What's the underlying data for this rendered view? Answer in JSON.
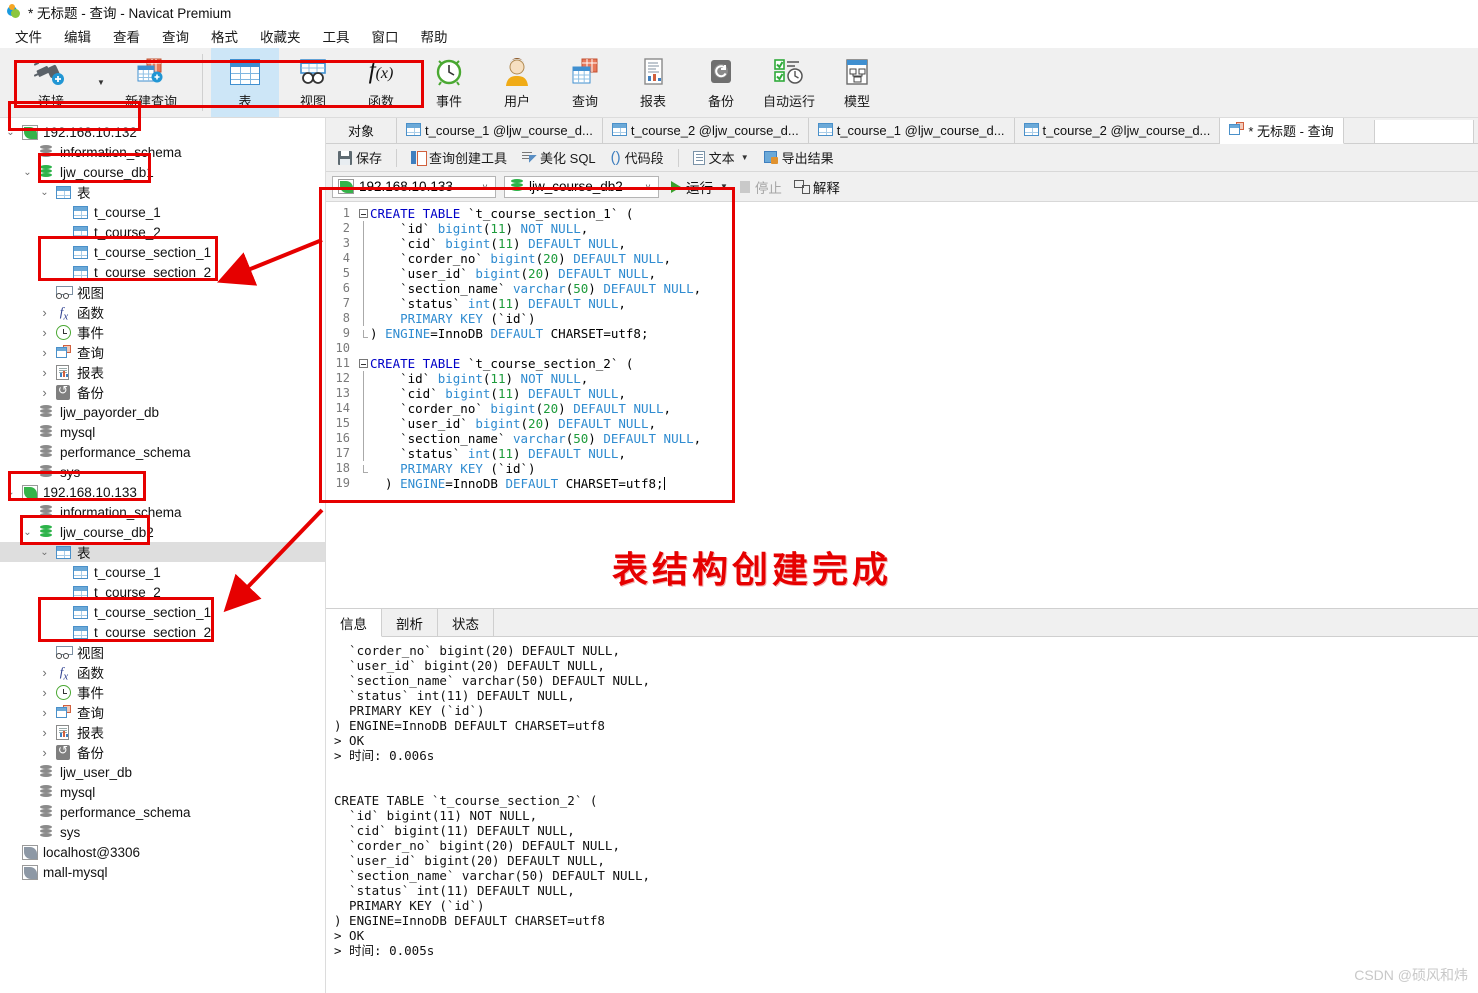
{
  "window": {
    "title": "* 无标题 - 查询 - Navicat Premium",
    "logo_icon": "navicat-logo-icon"
  },
  "menubar": {
    "items": [
      "文件",
      "编辑",
      "查看",
      "查询",
      "格式",
      "收藏夹",
      "工具",
      "窗口",
      "帮助"
    ]
  },
  "toolbar": {
    "left": [
      {
        "label": "连接",
        "icon": "connection-plug-icon",
        "has_caret": true
      },
      {
        "label": "新建查询",
        "icon": "new-query-icon",
        "has_caret": false
      }
    ],
    "items": [
      {
        "label": "表",
        "icon": "table-grid-icon",
        "active": true
      },
      {
        "label": "视图",
        "icon": "view-icon",
        "active": false
      },
      {
        "label": "函数",
        "icon": "function-fx-icon",
        "active": false
      },
      {
        "label": "事件",
        "icon": "event-clock-icon",
        "active": false
      },
      {
        "label": "用户",
        "icon": "user-icon",
        "active": false
      },
      {
        "label": "查询",
        "icon": "query-icon",
        "active": false
      },
      {
        "label": "报表",
        "icon": "report-icon",
        "active": false
      },
      {
        "label": "备份",
        "icon": "backup-icon",
        "active": false
      },
      {
        "label": "自动运行",
        "icon": "automation-icon",
        "active": false
      },
      {
        "label": "模型",
        "icon": "model-icon",
        "active": false
      }
    ]
  },
  "object_tabs": {
    "first_label": "对象",
    "tabs": [
      {
        "label": "t_course_1 @ljw_course_d...",
        "icon": "table-tab-icon",
        "active": false
      },
      {
        "label": "t_course_2 @ljw_course_d...",
        "icon": "table-tab-icon",
        "active": false
      },
      {
        "label": "t_course_1 @ljw_course_d...",
        "icon": "table-tab-icon",
        "active": false
      },
      {
        "label": "t_course_2 @ljw_course_d...",
        "icon": "table-tab-icon",
        "active": false
      },
      {
        "label": "* 无标题 - 查询",
        "icon": "query-tab-icon",
        "active": true
      }
    ]
  },
  "editor_toolbar": {
    "save": "保存",
    "query_builder": "查询创建工具",
    "beautify": "美化 SQL",
    "snippet": "代码段",
    "text": "文本",
    "export": "导出结果"
  },
  "selector": {
    "connection": "192.168.10.133",
    "database": "ljw_course_db2",
    "run": "运行",
    "stop": "停止",
    "explain": "解释"
  },
  "sql_editor": {
    "lines": [
      {
        "n": 1,
        "fold": "start",
        "tokens": [
          [
            "kw",
            "CREATE TABLE "
          ],
          [
            "id",
            "`t_course_section_1` ("
          ]
        ]
      },
      {
        "n": 2,
        "fold": "bar",
        "tokens": [
          [
            "txt",
            "    `id` "
          ],
          [
            "type",
            "bigint"
          ],
          [
            "id",
            "("
          ],
          [
            "num",
            "11"
          ],
          [
            "id",
            ") "
          ],
          [
            "type",
            "NOT NULL"
          ],
          [
            "id",
            ","
          ]
        ]
      },
      {
        "n": 3,
        "fold": "bar",
        "tokens": [
          [
            "txt",
            "    `cid` "
          ],
          [
            "type",
            "bigint"
          ],
          [
            "id",
            "("
          ],
          [
            "num",
            "11"
          ],
          [
            "id",
            ") "
          ],
          [
            "type",
            "DEFAULT NULL"
          ],
          [
            "id",
            ","
          ]
        ]
      },
      {
        "n": 4,
        "fold": "bar",
        "tokens": [
          [
            "txt",
            "    `corder_no` "
          ],
          [
            "type",
            "bigint"
          ],
          [
            "id",
            "("
          ],
          [
            "num",
            "20"
          ],
          [
            "id",
            ") "
          ],
          [
            "type",
            "DEFAULT NULL"
          ],
          [
            "id",
            ","
          ]
        ]
      },
      {
        "n": 5,
        "fold": "bar",
        "tokens": [
          [
            "txt",
            "    `user_id` "
          ],
          [
            "type",
            "bigint"
          ],
          [
            "id",
            "("
          ],
          [
            "num",
            "20"
          ],
          [
            "id",
            ") "
          ],
          [
            "type",
            "DEFAULT NULL"
          ],
          [
            "id",
            ","
          ]
        ]
      },
      {
        "n": 6,
        "fold": "bar",
        "tokens": [
          [
            "txt",
            "    `section_name` "
          ],
          [
            "type",
            "varchar"
          ],
          [
            "id",
            "("
          ],
          [
            "num",
            "50"
          ],
          [
            "id",
            ") "
          ],
          [
            "type",
            "DEFAULT NULL"
          ],
          [
            "id",
            ","
          ]
        ]
      },
      {
        "n": 7,
        "fold": "bar",
        "tokens": [
          [
            "txt",
            "    `status` "
          ],
          [
            "type",
            "int"
          ],
          [
            "id",
            "("
          ],
          [
            "num",
            "11"
          ],
          [
            "id",
            ") "
          ],
          [
            "type",
            "DEFAULT NULL"
          ],
          [
            "id",
            ","
          ]
        ]
      },
      {
        "n": 8,
        "fold": "bar",
        "tokens": [
          [
            "type",
            "    PRIMARY KEY "
          ],
          [
            "id",
            "(`id`)"
          ]
        ]
      },
      {
        "n": 9,
        "fold": "end",
        "tokens": [
          [
            "id",
            ") "
          ],
          [
            "type",
            "ENGINE"
          ],
          [
            "id",
            "=InnoDB "
          ],
          [
            "type",
            "DEFAULT"
          ],
          [
            "id",
            " CHARSET=utf8;"
          ]
        ]
      },
      {
        "n": 10,
        "fold": "none",
        "tokens": [
          [
            "txt",
            ""
          ]
        ]
      },
      {
        "n": 11,
        "fold": "start",
        "tokens": [
          [
            "kw",
            "CREATE TABLE "
          ],
          [
            "id",
            "`t_course_section_2` ("
          ]
        ]
      },
      {
        "n": 12,
        "fold": "bar",
        "tokens": [
          [
            "txt",
            "    `id` "
          ],
          [
            "type",
            "bigint"
          ],
          [
            "id",
            "("
          ],
          [
            "num",
            "11"
          ],
          [
            "id",
            ") "
          ],
          [
            "type",
            "NOT NULL"
          ],
          [
            "id",
            ","
          ]
        ]
      },
      {
        "n": 13,
        "fold": "bar",
        "tokens": [
          [
            "txt",
            "    `cid` "
          ],
          [
            "type",
            "bigint"
          ],
          [
            "id",
            "("
          ],
          [
            "num",
            "11"
          ],
          [
            "id",
            ") "
          ],
          [
            "type",
            "DEFAULT NULL"
          ],
          [
            "id",
            ","
          ]
        ]
      },
      {
        "n": 14,
        "fold": "bar",
        "tokens": [
          [
            "txt",
            "    `corder_no` "
          ],
          [
            "type",
            "bigint"
          ],
          [
            "id",
            "("
          ],
          [
            "num",
            "20"
          ],
          [
            "id",
            ") "
          ],
          [
            "type",
            "DEFAULT NULL"
          ],
          [
            "id",
            ","
          ]
        ]
      },
      {
        "n": 15,
        "fold": "bar",
        "tokens": [
          [
            "txt",
            "    `user_id` "
          ],
          [
            "type",
            "bigint"
          ],
          [
            "id",
            "("
          ],
          [
            "num",
            "20"
          ],
          [
            "id",
            ") "
          ],
          [
            "type",
            "DEFAULT NULL"
          ],
          [
            "id",
            ","
          ]
        ]
      },
      {
        "n": 16,
        "fold": "bar",
        "tokens": [
          [
            "txt",
            "    `section_name` "
          ],
          [
            "type",
            "varchar"
          ],
          [
            "id",
            "("
          ],
          [
            "num",
            "50"
          ],
          [
            "id",
            ") "
          ],
          [
            "type",
            "DEFAULT NULL"
          ],
          [
            "id",
            ","
          ]
        ]
      },
      {
        "n": 17,
        "fold": "bar",
        "tokens": [
          [
            "txt",
            "    `status` "
          ],
          [
            "type",
            "int"
          ],
          [
            "id",
            "("
          ],
          [
            "num",
            "11"
          ],
          [
            "id",
            ") "
          ],
          [
            "type",
            "DEFAULT NULL"
          ],
          [
            "id",
            ","
          ]
        ]
      },
      {
        "n": 18,
        "fold": "end",
        "tokens": [
          [
            "type",
            "    PRIMARY KEY "
          ],
          [
            "id",
            "(`id`)"
          ]
        ]
      },
      {
        "n": 19,
        "fold": "none",
        "tokens": [
          [
            "id",
            "  ) "
          ],
          [
            "type",
            "ENGINE"
          ],
          [
            "id",
            "=InnoDB "
          ],
          [
            "type",
            "DEFAULT"
          ],
          [
            "id",
            " CHARSET=utf8;"
          ]
        ],
        "caret": true
      }
    ]
  },
  "results": {
    "tabs": [
      {
        "label": "信息",
        "active": true
      },
      {
        "label": "剖析",
        "active": false
      },
      {
        "label": "状态",
        "active": false
      }
    ],
    "lines": [
      "  `corder_no` bigint(20) DEFAULT NULL,",
      "  `user_id` bigint(20) DEFAULT NULL,",
      "  `section_name` varchar(50) DEFAULT NULL,",
      "  `status` int(11) DEFAULT NULL,",
      "  PRIMARY KEY (`id`)",
      ") ENGINE=InnoDB DEFAULT CHARSET=utf8",
      "> OK",
      "> 时间: 0.006s",
      "",
      "",
      "CREATE TABLE `t_course_section_2` (",
      "  `id` bigint(11) NOT NULL,",
      "  `cid` bigint(11) DEFAULT NULL,",
      "  `corder_no` bigint(20) DEFAULT NULL,",
      "  `user_id` bigint(20) DEFAULT NULL,",
      "  `section_name` varchar(50) DEFAULT NULL,",
      "  `status` int(11) DEFAULT NULL,",
      "  PRIMARY KEY (`id`)",
      ") ENGINE=InnoDB DEFAULT CHARSET=utf8",
      "> OK",
      "> 时间: 0.005s"
    ]
  },
  "tree": {
    "nodes": [
      {
        "label": "192.168.10.132",
        "icon": "connection-green-icon",
        "indent": 0,
        "twisty": "down",
        "selected": false
      },
      {
        "label": "information_schema",
        "icon": "database-gray-icon",
        "indent": 1,
        "twisty": "",
        "selected": false
      },
      {
        "label": "ljw_course_db1",
        "icon": "database-green-icon",
        "indent": 1,
        "twisty": "down",
        "selected": false
      },
      {
        "label": "表",
        "icon": "table-folder-icon",
        "indent": 2,
        "twisty": "down",
        "selected": false
      },
      {
        "label": "t_course_1",
        "icon": "table-icon",
        "indent": 3,
        "twisty": "",
        "selected": false
      },
      {
        "label": "t_course_2",
        "icon": "table-icon",
        "indent": 3,
        "twisty": "",
        "selected": false
      },
      {
        "label": "t_course_section_1",
        "icon": "table-icon",
        "indent": 3,
        "twisty": "",
        "selected": false
      },
      {
        "label": "t_course_section_2",
        "icon": "table-icon",
        "indent": 3,
        "twisty": "",
        "selected": false
      },
      {
        "label": "视图",
        "icon": "view-icon",
        "indent": 2,
        "twisty": "",
        "selected": false
      },
      {
        "label": "函数",
        "icon": "function-fx-icon",
        "indent": 2,
        "twisty": "right",
        "selected": false
      },
      {
        "label": "事件",
        "icon": "event-clock-icon",
        "indent": 2,
        "twisty": "right",
        "selected": false
      },
      {
        "label": "查询",
        "icon": "query-icon",
        "indent": 2,
        "twisty": "right",
        "selected": false
      },
      {
        "label": "报表",
        "icon": "report-icon",
        "indent": 2,
        "twisty": "right",
        "selected": false
      },
      {
        "label": "备份",
        "icon": "backup-icon",
        "indent": 2,
        "twisty": "right",
        "selected": false
      },
      {
        "label": "ljw_payorder_db",
        "icon": "database-gray-icon",
        "indent": 1,
        "twisty": "",
        "selected": false
      },
      {
        "label": "mysql",
        "icon": "database-gray-icon",
        "indent": 1,
        "twisty": "",
        "selected": false
      },
      {
        "label": "performance_schema",
        "icon": "database-gray-icon",
        "indent": 1,
        "twisty": "",
        "selected": false
      },
      {
        "label": "sys",
        "icon": "database-gray-icon",
        "indent": 1,
        "twisty": "",
        "selected": false
      },
      {
        "label": "192.168.10.133",
        "icon": "connection-green-icon",
        "indent": 0,
        "twisty": "down",
        "selected": false
      },
      {
        "label": "information_schema",
        "icon": "database-gray-icon",
        "indent": 1,
        "twisty": "",
        "selected": false
      },
      {
        "label": "ljw_course_db2",
        "icon": "database-green-icon",
        "indent": 1,
        "twisty": "down",
        "selected": false
      },
      {
        "label": "表",
        "icon": "table-folder-icon",
        "indent": 2,
        "twisty": "down",
        "selected": true
      },
      {
        "label": "t_course_1",
        "icon": "table-icon",
        "indent": 3,
        "twisty": "",
        "selected": false
      },
      {
        "label": "t_course_2",
        "icon": "table-icon",
        "indent": 3,
        "twisty": "",
        "selected": false
      },
      {
        "label": "t_course_section_1",
        "icon": "table-icon",
        "indent": 3,
        "twisty": "",
        "selected": false
      },
      {
        "label": "t_course_section_2",
        "icon": "table-icon",
        "indent": 3,
        "twisty": "",
        "selected": false
      },
      {
        "label": "视图",
        "icon": "view-icon",
        "indent": 2,
        "twisty": "",
        "selected": false
      },
      {
        "label": "函数",
        "icon": "function-fx-icon",
        "indent": 2,
        "twisty": "right",
        "selected": false
      },
      {
        "label": "事件",
        "icon": "event-clock-icon",
        "indent": 2,
        "twisty": "right",
        "selected": false
      },
      {
        "label": "查询",
        "icon": "query-icon",
        "indent": 2,
        "twisty": "right",
        "selected": false
      },
      {
        "label": "报表",
        "icon": "report-icon",
        "indent": 2,
        "twisty": "right",
        "selected": false
      },
      {
        "label": "备份",
        "icon": "backup-icon",
        "indent": 2,
        "twisty": "right",
        "selected": false
      },
      {
        "label": "ljw_user_db",
        "icon": "database-gray-icon",
        "indent": 1,
        "twisty": "",
        "selected": false
      },
      {
        "label": "mysql",
        "icon": "database-gray-icon",
        "indent": 1,
        "twisty": "",
        "selected": false
      },
      {
        "label": "performance_schema",
        "icon": "database-gray-icon",
        "indent": 1,
        "twisty": "",
        "selected": false
      },
      {
        "label": "sys",
        "icon": "database-gray-icon",
        "indent": 1,
        "twisty": "",
        "selected": false
      },
      {
        "label": "localhost@3306",
        "icon": "connection-gray-icon",
        "indent": 0,
        "twisty": "",
        "selected": false
      },
      {
        "label": "mall-mysql",
        "icon": "connection-gray-icon",
        "indent": 0,
        "twisty": "",
        "selected": false
      }
    ]
  },
  "annotations": {
    "callout_text": "表结构创建完成",
    "accent_color": "#e60000",
    "watermark": "CSDN @硕风和炜"
  }
}
